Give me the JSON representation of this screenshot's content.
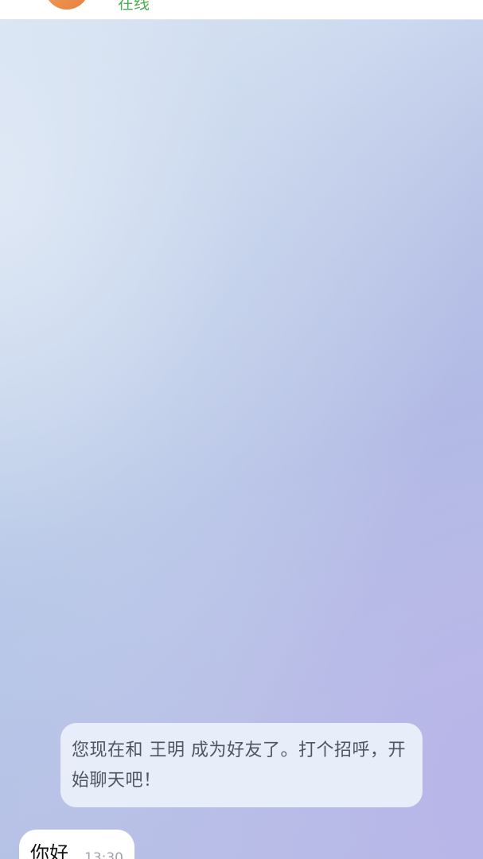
{
  "header": {
    "contact_status": "在线",
    "avatar_color": "#ee8c45",
    "status_color": "#4caf50"
  },
  "chat": {
    "system_message": "您现在和 王明 成为好友了。打个招呼，开始聊天吧！",
    "messages": [
      {
        "text": "你好",
        "time": "13:30"
      }
    ]
  }
}
